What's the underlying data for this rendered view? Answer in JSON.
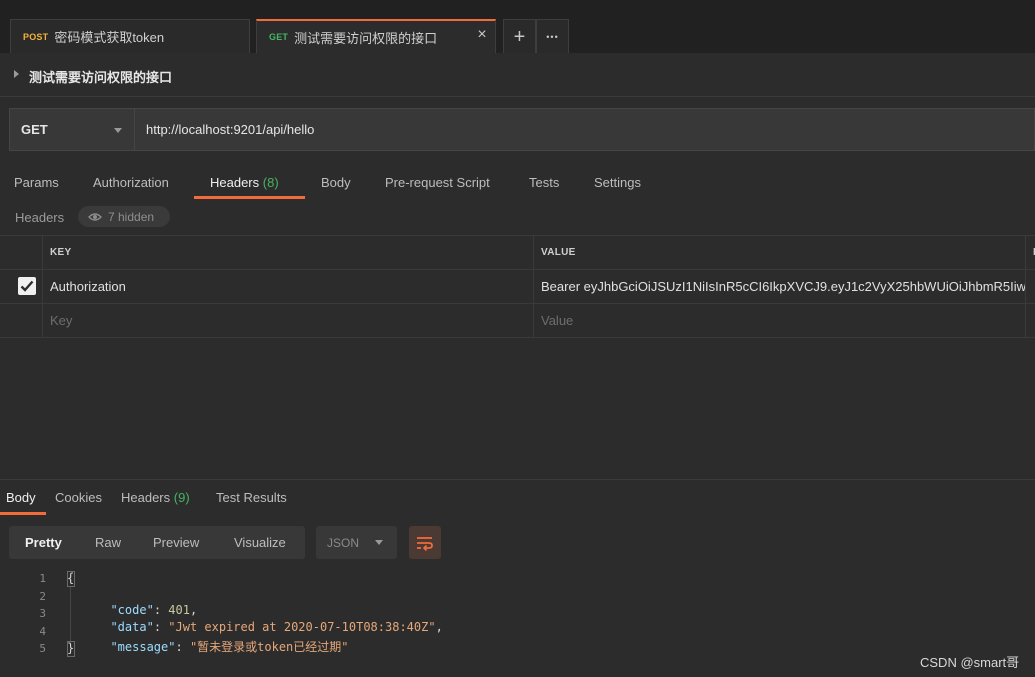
{
  "tabs": [
    {
      "method": "POST",
      "label": "密码模式获取token"
    },
    {
      "method": "GET",
      "label": "测试需要访问权限的接口"
    }
  ],
  "tab_close": "×",
  "new_tab": "+",
  "more_tabs": "•••",
  "request": {
    "name": "测试需要访问权限的接口",
    "method": "GET",
    "url": "http://localhost:9201/api/hello"
  },
  "request_tabs": {
    "params": "Params",
    "authorization": "Authorization",
    "headers": "Headers",
    "headers_count": "(8)",
    "body": "Body",
    "pre_request": "Pre-request Script",
    "tests": "Tests",
    "settings": "Settings"
  },
  "headers_section": {
    "label": "Headers",
    "hidden": "7 hidden",
    "col_key": "KEY",
    "col_value": "VALUE",
    "col_extra": "D",
    "row": {
      "key": "Authorization",
      "value": "Bearer eyJhbGciOiJSUzI1NiIsInR5cCI6IkpXVCJ9.eyJ1c2VyX25hbWUiOiJhbmR5Iiw"
    },
    "key_placeholder": "Key",
    "value_placeholder": "Value"
  },
  "response_tabs": {
    "body": "Body",
    "cookies": "Cookies",
    "headers": "Headers",
    "headers_count": "(9)",
    "test_results": "Test Results"
  },
  "view_modes": {
    "pretty": "Pretty",
    "raw": "Raw",
    "preview": "Preview",
    "visualize": "Visualize"
  },
  "format": "JSON",
  "code": {
    "line_numbers": [
      "1",
      "2",
      "3",
      "4",
      "5"
    ],
    "open": "{",
    "close": "}",
    "code_key": "\"code\"",
    "code_val": "401",
    "data_key": "\"data\"",
    "data_val": "\"Jwt expired at 2020-07-10T08:38:40Z\"",
    "message_key": "\"message\"",
    "message_val": "\"暂未登录或token已经过期\""
  },
  "watermark": "CSDN @smart哥",
  "colors": {
    "accent": "#f26b3a",
    "get": "#47b561",
    "post": "#f2b33a",
    "count": "#47b561"
  }
}
